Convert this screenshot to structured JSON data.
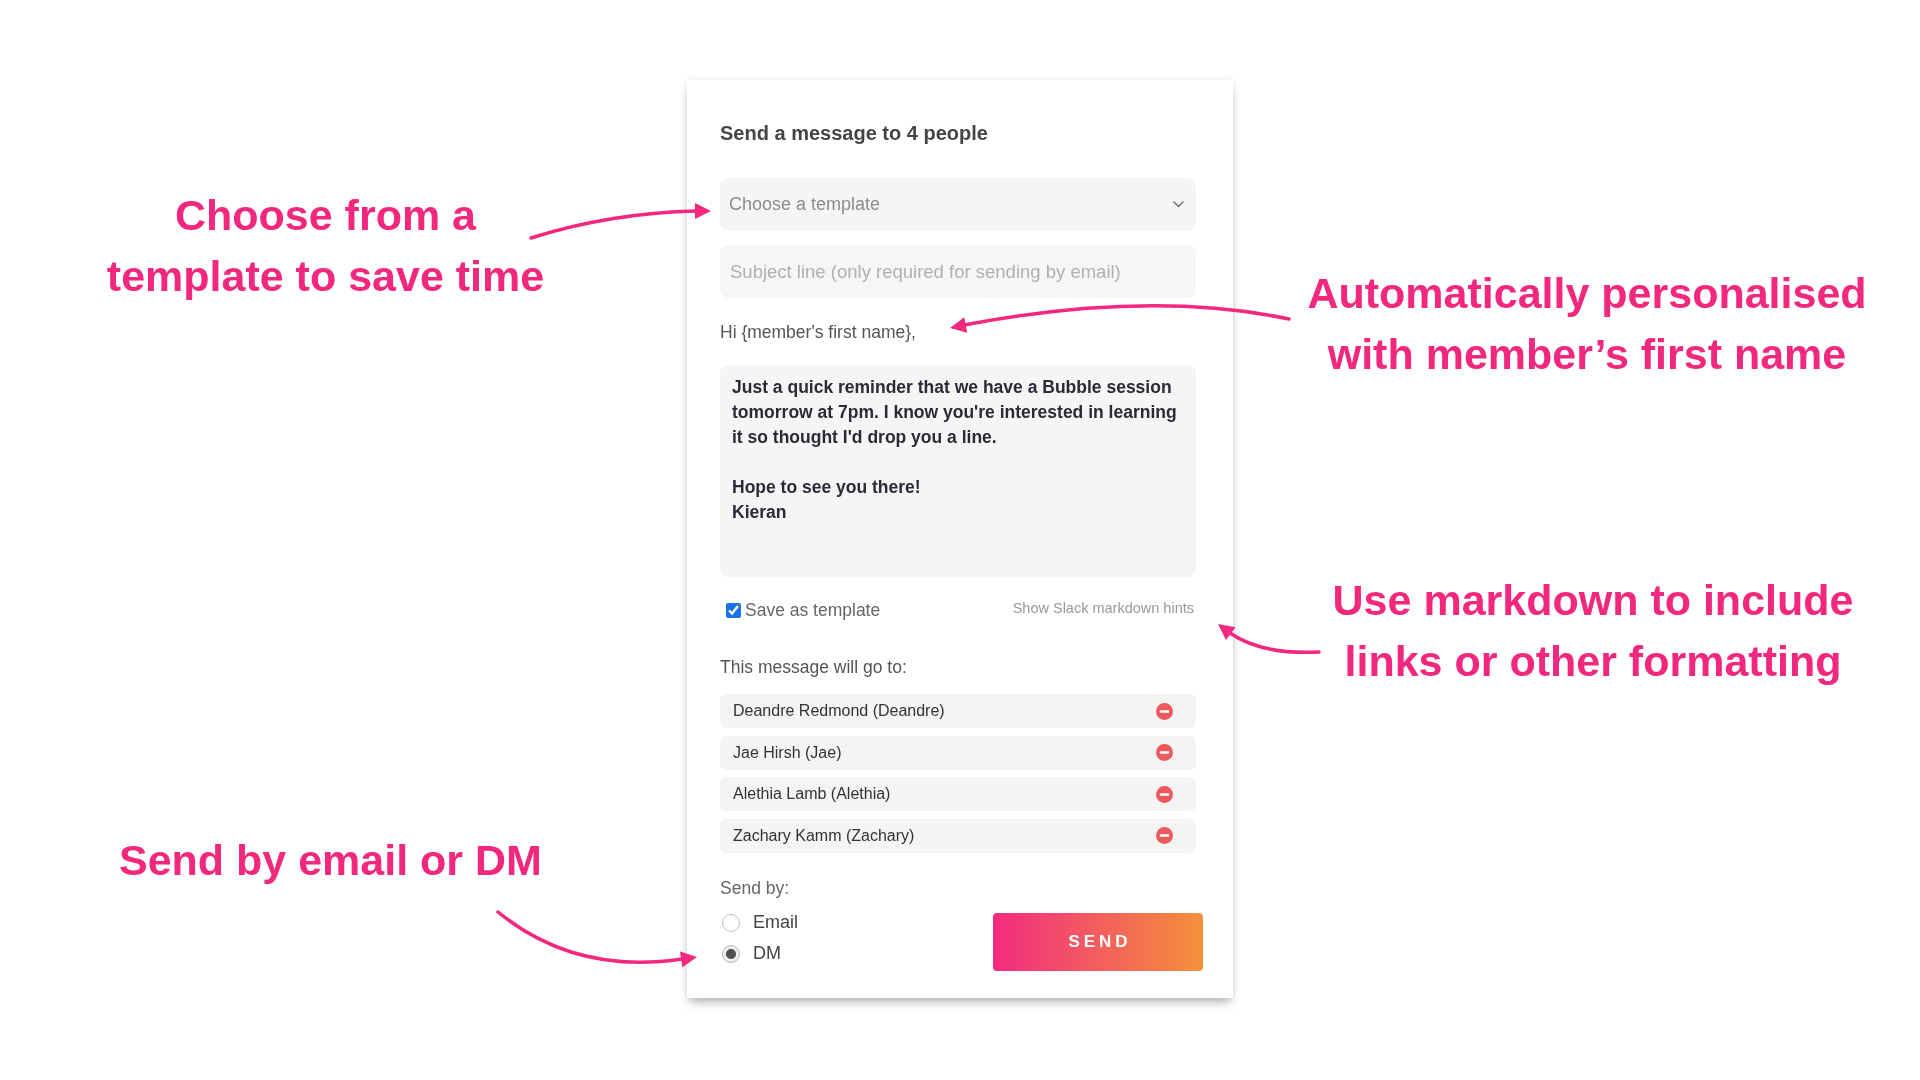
{
  "left_annotations": [
    "Choose from a\ntemplate to save time",
    "Send by email or DM"
  ],
  "dialog": {
    "title": "Send a message to 4 people",
    "template_select": {
      "placeholder": "Choose a template"
    },
    "subject": {
      "placeholder": "Subject line (only required for sending by email)"
    },
    "greeting": "Hi {member's first name},",
    "message": {
      "value": "Just a quick reminder that we have a Bubble session tomorrow at 7pm. I know you're interested in learning it so thought I'd drop you a line.\n\nHope to see you there!\nKieran"
    },
    "save_as_template": {
      "label": "Save as template",
      "checked": true
    },
    "markdown_hints_link": "Show Slack markdown hints",
    "recipients_label": "This message will go to:",
    "recipients": [
      {
        "name": "Deandre Redmond (Deandre)"
      },
      {
        "name": "Jae Hirsh (Jae)"
      },
      {
        "name": "Alethia Lamb (Alethia)"
      },
      {
        "name": "Zachary Kamm (Zachary)"
      }
    ],
    "send_by": {
      "label": "Send by:",
      "options": [
        {
          "label": "Email",
          "selected": false
        },
        {
          "label": "DM",
          "selected": true
        }
      ]
    },
    "send_button": "SEND"
  },
  "right_annotations": [
    "Automatically personalised\nwith member’s first name",
    "Use markdown to include\nlinks or other formatting"
  ]
}
